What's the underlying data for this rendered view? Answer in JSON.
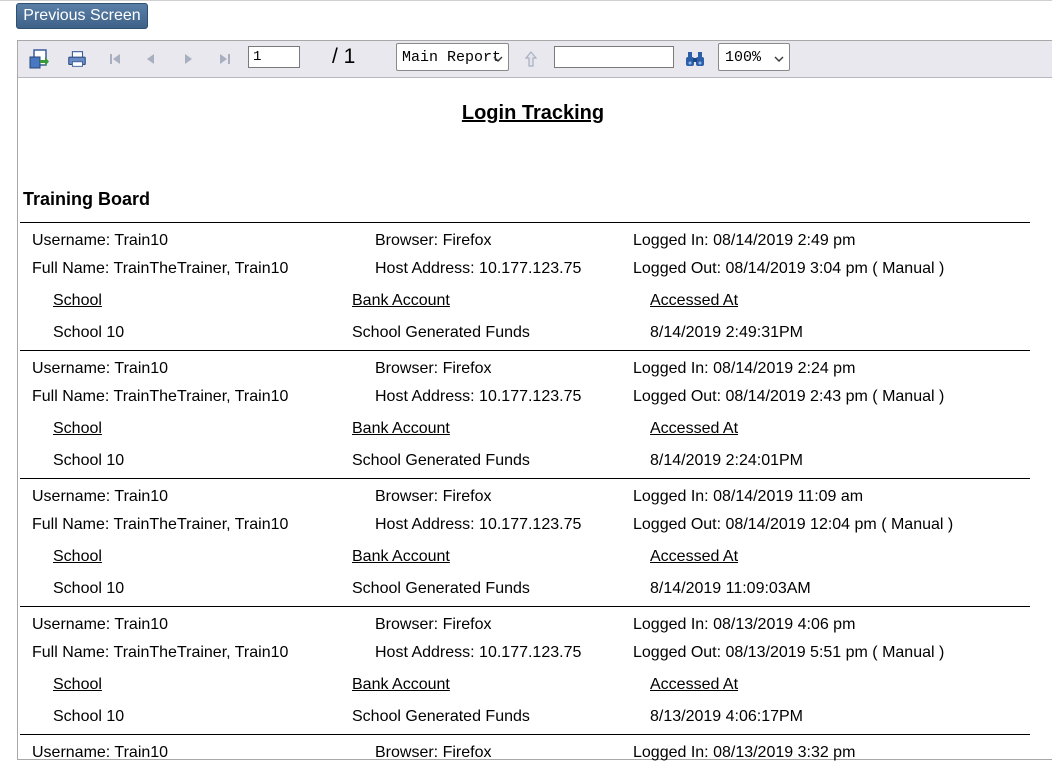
{
  "nav": {
    "previous_label": "Previous Screen"
  },
  "toolbar": {
    "export_icon": "export-icon",
    "print_icon": "print-icon",
    "page_value": "1",
    "page_total": "/ 1",
    "report_select": "Main Report",
    "search_value": "",
    "zoom_select": "100%"
  },
  "report": {
    "title": "Login Tracking",
    "board": "Training Board",
    "header_school": "School",
    "header_bank": "Bank Account",
    "header_accessed": "Accessed At",
    "records": [
      {
        "username": "Username: Train10",
        "browser": "Browser: Firefox",
        "logged_in": "Logged In: 08/14/2019   2:49 pm",
        "full_name": "Full Name: TrainTheTrainer, Train10",
        "host": "Host Address: 10.177.123.75",
        "logged_out": "Logged Out: 08/14/2019   3:04 pm ( Manual )",
        "school": "School 10",
        "bank": "School Generated Funds",
        "accessed": "8/14/2019   2:49:31PM"
      },
      {
        "username": "Username: Train10",
        "browser": "Browser: Firefox",
        "logged_in": "Logged In: 08/14/2019   2:24 pm",
        "full_name": "Full Name: TrainTheTrainer, Train10",
        "host": "Host Address: 10.177.123.75",
        "logged_out": "Logged Out: 08/14/2019   2:43 pm ( Manual )",
        "school": "School 10",
        "bank": "School Generated Funds",
        "accessed": "8/14/2019   2:24:01PM"
      },
      {
        "username": "Username: Train10",
        "browser": "Browser: Firefox",
        "logged_in": "Logged In: 08/14/2019  11:09 am",
        "full_name": "Full Name: TrainTheTrainer, Train10",
        "host": "Host Address: 10.177.123.75",
        "logged_out": "Logged Out: 08/14/2019  12:04 pm ( Manual )",
        "school": "School 10",
        "bank": "School Generated Funds",
        "accessed": "8/14/2019  11:09:03AM"
      },
      {
        "username": "Username: Train10",
        "browser": "Browser: Firefox",
        "logged_in": "Logged In: 08/13/2019   4:06 pm",
        "full_name": "Full Name: TrainTheTrainer, Train10",
        "host": "Host Address: 10.177.123.75",
        "logged_out": "Logged Out: 08/13/2019   5:51 pm ( Manual )",
        "school": "School 10",
        "bank": "School Generated Funds",
        "accessed": "8/13/2019   4:06:17PM"
      },
      {
        "username": "Username: Train10",
        "browser": "Browser: Firefox",
        "logged_in": "Logged In: 08/13/2019   3:32 pm",
        "full_name": "",
        "host": "",
        "logged_out": "",
        "school": "",
        "bank": "",
        "accessed": ""
      }
    ]
  }
}
